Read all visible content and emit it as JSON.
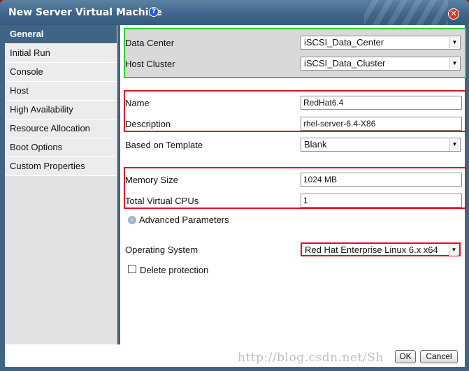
{
  "window": {
    "title": "New Server Virtual Machine",
    "help_icon": "help-icon",
    "close_icon": "close-icon",
    "help_glyph": "?",
    "close_glyph": "✕"
  },
  "sidebar": {
    "items": [
      {
        "label": "General",
        "active": true
      },
      {
        "label": "Initial Run",
        "active": false
      },
      {
        "label": "Console",
        "active": false
      },
      {
        "label": "Host",
        "active": false
      },
      {
        "label": "High Availability",
        "active": false
      },
      {
        "label": "Resource Allocation",
        "active": false
      },
      {
        "label": "Boot Options",
        "active": false
      },
      {
        "label": "Custom Properties",
        "active": false
      }
    ]
  },
  "form": {
    "data_center_label": "Data Center",
    "data_center_value": "iSCSI_Data_Center",
    "host_cluster_label": "Host Cluster",
    "host_cluster_value": "iSCSI_Data_Cluster",
    "name_label": "Name",
    "name_value": "RedHat6.4",
    "description_label": "Description",
    "description_value": "rhel-server-6.4-X86",
    "template_label": "Based on Template",
    "template_value": "Blank",
    "memory_label": "Memory Size",
    "memory_value": "1024 MB",
    "cpus_label": "Total Virtual CPUs",
    "cpus_value": "1",
    "advanced_label": "Advanced Parameters",
    "os_label": "Operating System",
    "os_value": "Red Hat Enterprise Linux 6.x x64",
    "delete_protection_label": "Delete protection"
  },
  "footer": {
    "ok_label": "OK",
    "cancel_label": "Cancel",
    "watermark": "http://blog.csdn.net/Sh"
  },
  "colors": {
    "accent": "#3f6485",
    "green_outline": "#33cc33",
    "red_outline": "#dd1122"
  }
}
